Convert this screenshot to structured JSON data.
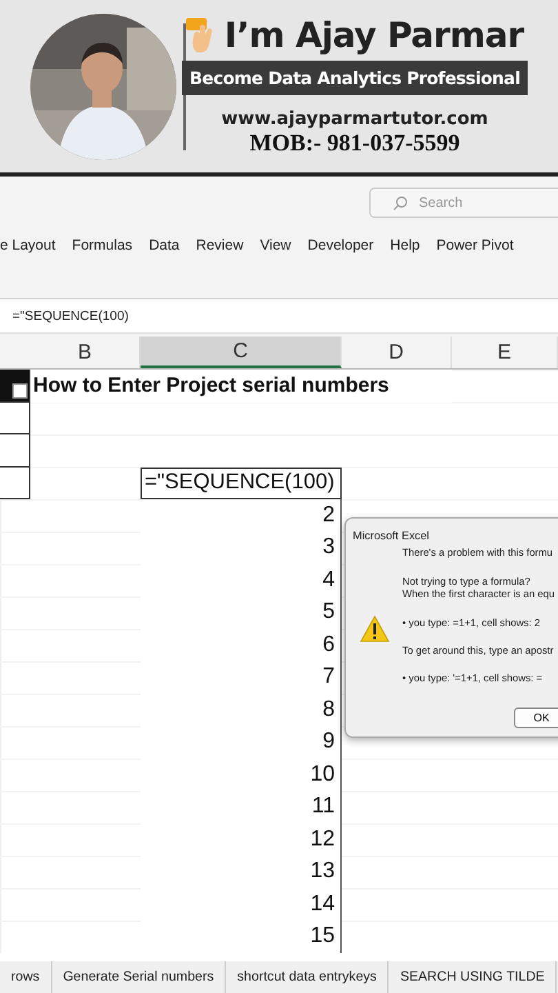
{
  "banner": {
    "name": "I’m Ajay Parmar",
    "tagline": "Become Data Analytics Professional",
    "website": "www.ajayparmartutor.com",
    "phone": "MOB:- 981-037-5599"
  },
  "search": {
    "placeholder": "Search"
  },
  "ribbon_tabs": [
    "e Layout",
    "Formulas",
    "Data",
    "Review",
    "View",
    "Developer",
    "Help",
    "Power Pivot"
  ],
  "formula_bar": {
    "value": "=\"SEQUENCE(100)"
  },
  "columns": [
    {
      "label": "B",
      "selected": false
    },
    {
      "label": "C",
      "selected": true
    },
    {
      "label": "D",
      "selected": false
    },
    {
      "label": "E",
      "selected": false
    }
  ],
  "sheet": {
    "title": "How to Enter Project serial numbers",
    "formula_cell": "=\"SEQUENCE(100)",
    "values": [
      "2",
      "3",
      "4",
      "5",
      "6",
      "7",
      "8",
      "9",
      "10",
      "11",
      "12",
      "13",
      "14",
      "15"
    ]
  },
  "dialog": {
    "title": "Microsoft Excel",
    "lines": [
      "There's a problem with this formu",
      "Not trying to type a formula?",
      "When the first character is an equ",
      "• you type:  =1+1, cell shows:  2",
      "To get around this, type an apostr",
      "• you type:  '=1+1, cell shows:  ="
    ],
    "button": "OK"
  },
  "sheet_tabs": [
    "rows",
    "Generate Serial numbers",
    "shortcut data entrykeys",
    "SEARCH USING TILDE"
  ]
}
